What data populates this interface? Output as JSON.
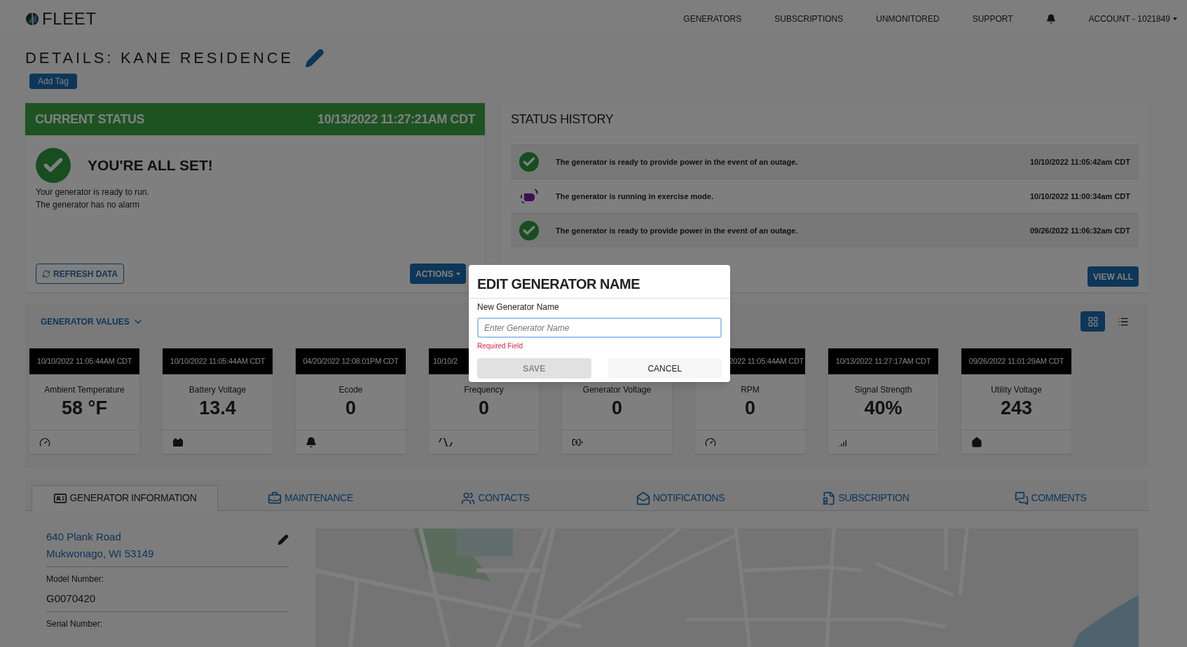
{
  "brand": {
    "name": "FLEET"
  },
  "nav": {
    "items": [
      "GENERATORS",
      "SUBSCRIPTIONS",
      "UNMONITORED",
      "SUPPORT"
    ],
    "account": "ACCOUNT - 1021849"
  },
  "page": {
    "title": "DETAILS: KANE RESIDENCE",
    "add_tag": "Add Tag"
  },
  "current_status": {
    "title": "CURRENT STATUS",
    "timestamp": "10/13/2022 11:27:21AM CDT",
    "headline": "YOU'RE ALL SET!",
    "lines": [
      "Your generator is ready to run.",
      "The generator has no alarm"
    ],
    "refresh": "REFRESH DATA",
    "actions": "ACTIONS"
  },
  "status_history": {
    "title": "STATUS HISTORY",
    "rows": [
      {
        "kind": "ready",
        "message": "The generator is ready to provide power in the event of an outage.",
        "time": "10/10/2022 11:05:42am CDT"
      },
      {
        "kind": "exercise",
        "message": "The generator is running in exercise mode.",
        "time": "10/10/2022 11:00:34am CDT"
      },
      {
        "kind": "ready",
        "message": "The generator is ready to provide power in the event of an outage.",
        "time": "09/26/2022 11:06:32am CDT"
      }
    ],
    "view_all": "VIEW ALL"
  },
  "generator_values": {
    "title": "GENERATOR VALUES",
    "views": [
      {
        "kind": "grid",
        "selected": true
      },
      {
        "kind": "list",
        "selected": false
      }
    ],
    "cards": [
      {
        "kind": "gauge",
        "timestamp": "10/10/2022 11:05:44AM CDT",
        "label": "Ambient Temperature",
        "value": "58 °F"
      },
      {
        "kind": "battery",
        "timestamp": "10/10/2022 11:05:44AM CDT",
        "label": "Battery Voltage",
        "value": "13.4"
      },
      {
        "kind": "bell",
        "timestamp": "04/20/2022 12:08:01PM CDT",
        "label": "Ecode",
        "value": "0"
      },
      {
        "kind": "wave",
        "timestamp": "10/10/2",
        "cut_end": true,
        "label": "Frequency",
        "value": "0"
      },
      {
        "kind": "charging",
        "label": "Generator Voltage",
        "value": "0"
      },
      {
        "kind": "gauge",
        "timestamp": "2022 11:05:44AM CDT",
        "cut_start": true,
        "label": "RPM",
        "value": "0"
      },
      {
        "kind": "signal",
        "timestamp": "10/13/2022 11:27:17AM CDT",
        "label": "Signal Strength",
        "value": "40%"
      },
      {
        "kind": "home",
        "timestamp": "09/26/2022 11:01:29AM CDT",
        "label": "Utility Voltage",
        "value": "243"
      }
    ]
  },
  "tabs": [
    {
      "kind": "id",
      "label": "GENERATOR INFORMATION",
      "selected": true
    },
    {
      "kind": "toolbox",
      "label": "MAINTENANCE",
      "selected": false
    },
    {
      "kind": "users",
      "label": "CONTACTS",
      "selected": false
    },
    {
      "kind": "mail",
      "label": "NOTIFICATIONS",
      "selected": false
    },
    {
      "kind": "file",
      "label": "SUBSCRIPTION",
      "selected": false
    },
    {
      "kind": "comments",
      "label": "COMMENTS",
      "selected": false
    }
  ],
  "info": {
    "address": [
      "640 Plank Road",
      "Mukwonago, WI 53149"
    ],
    "fields": [
      {
        "label": "Model Number:",
        "value": "G0070420"
      },
      {
        "label": "Serial Number:"
      }
    ],
    "map": {
      "kind": "picture"
    }
  },
  "modal": {
    "title": "EDIT GENERATOR NAME",
    "label": "New Generator Name",
    "placeholder": "Enter Generator Name",
    "error": "Required Field",
    "save": {
      "label": "SAVE",
      "disabled": true
    },
    "cancel": "CANCEL"
  }
}
